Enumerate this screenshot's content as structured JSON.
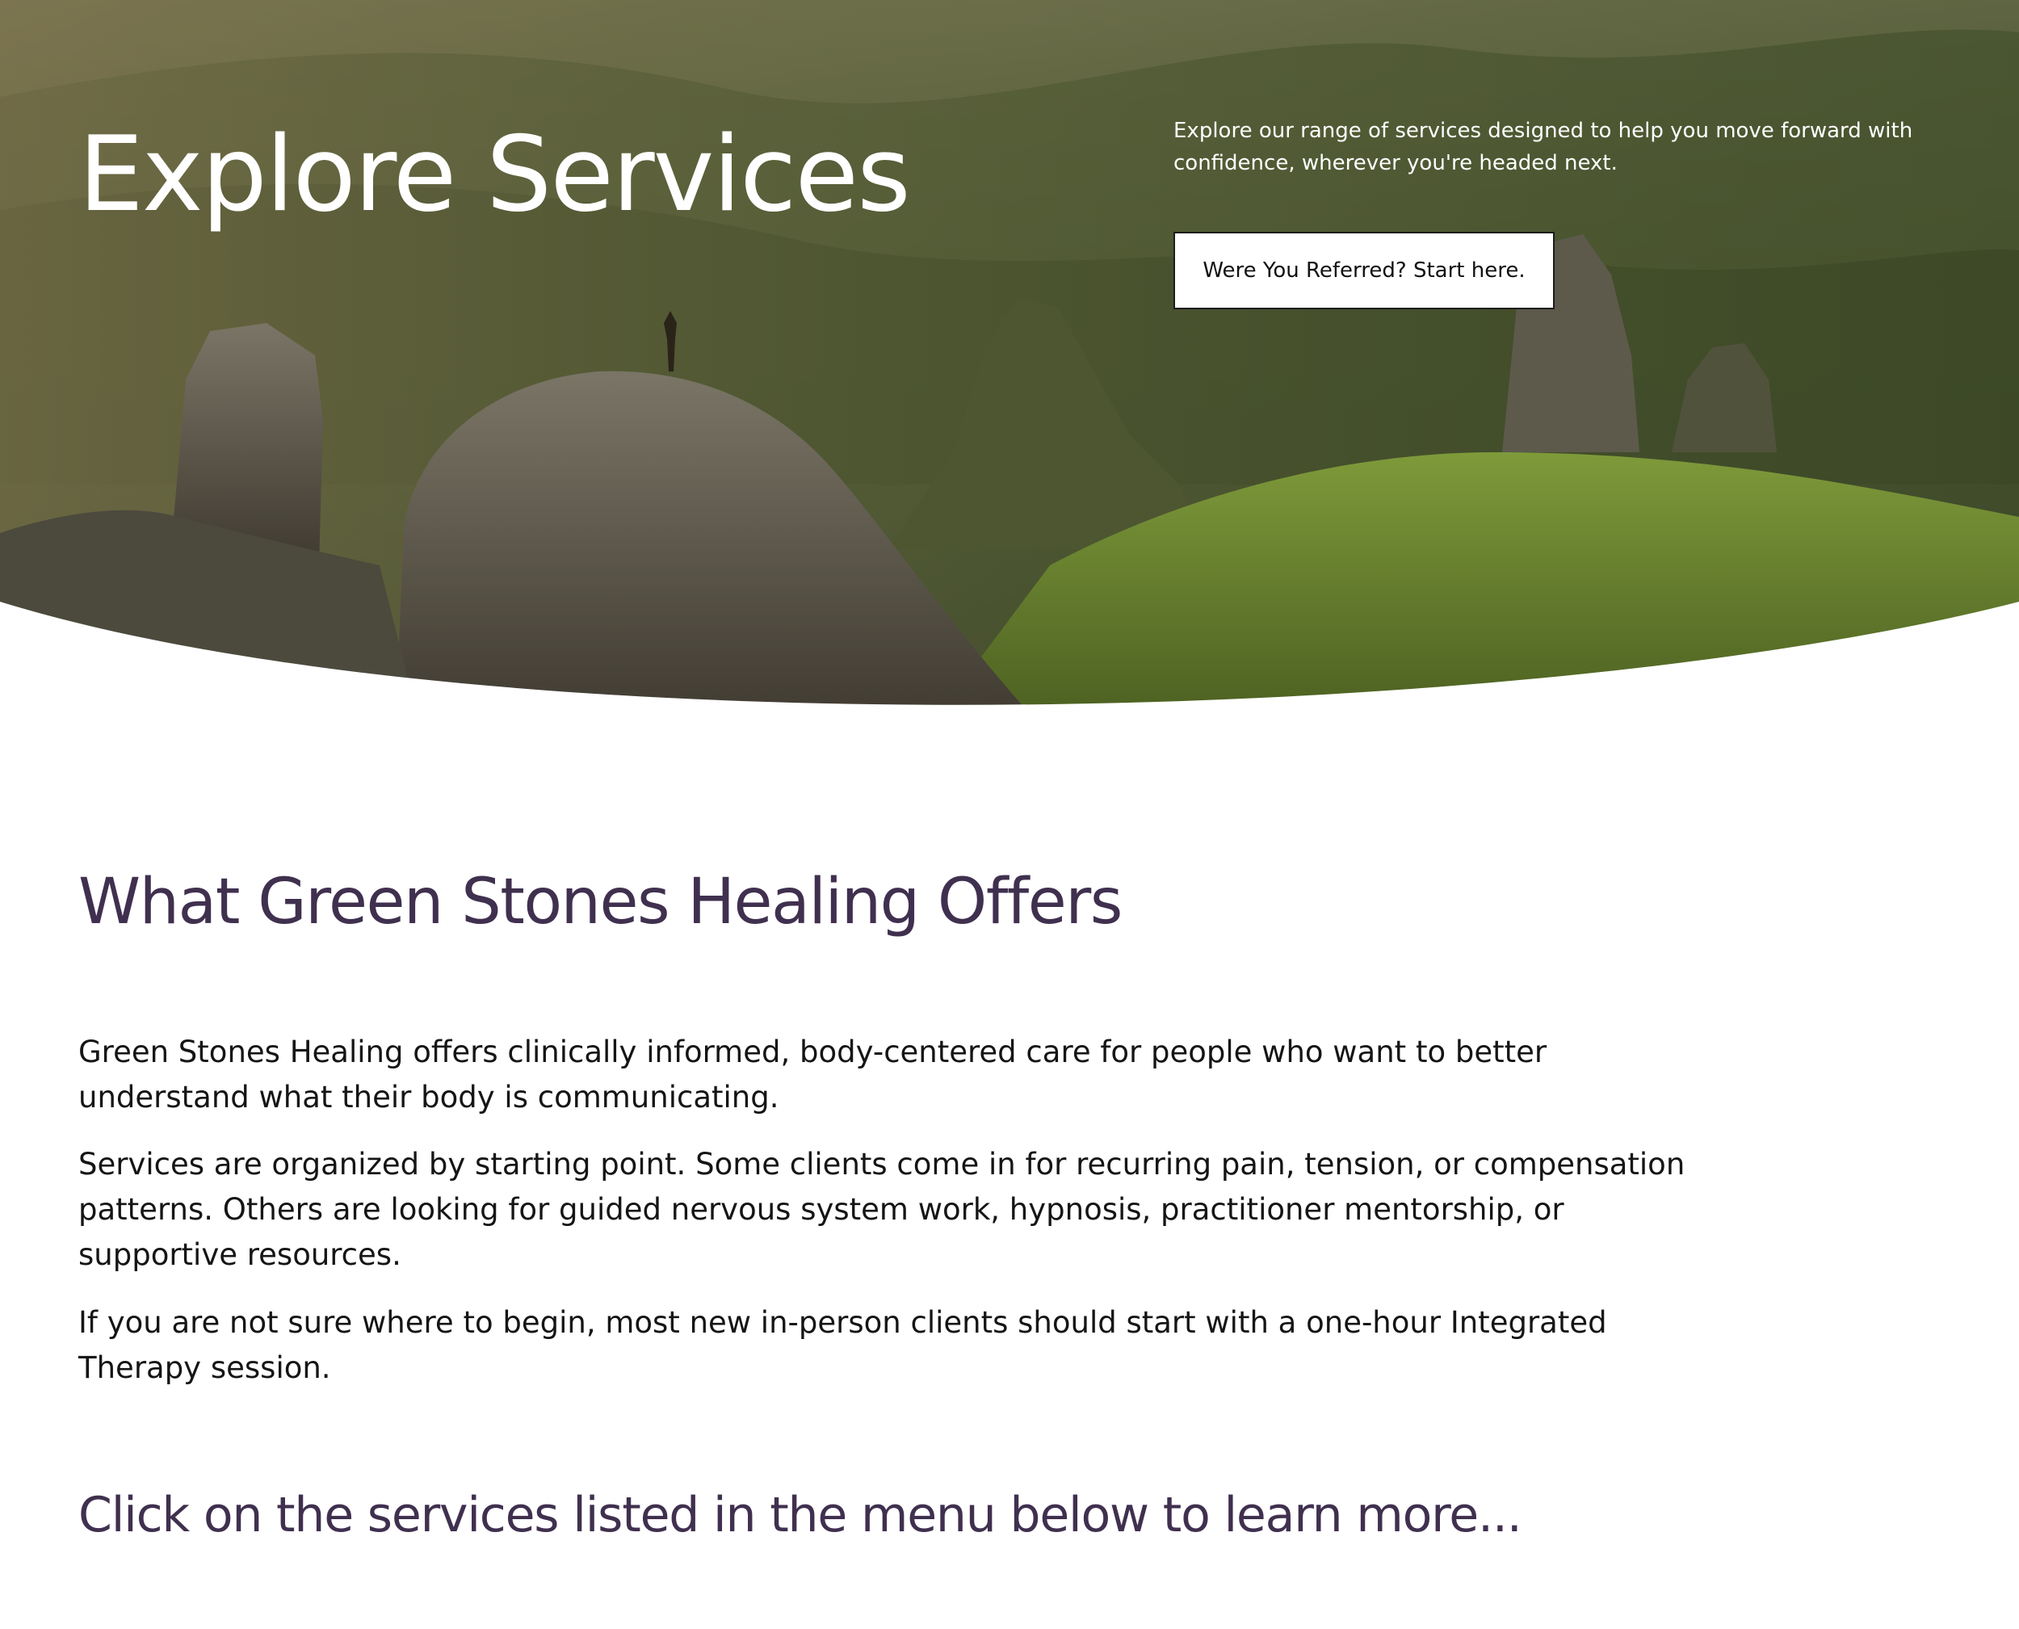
{
  "hero": {
    "title": "Explore Services",
    "description": "Explore our range of services designed to help you move forward with confidence, wherever you're headed next.",
    "button_label": "Were You Referred? Start here."
  },
  "offers": {
    "heading": "What Green Stones Healing Offers",
    "paragraphs": [
      "Green Stones Healing offers clinically informed, body-centered care for people who want to better understand what their body is communicating.",
      "Services are organized by starting point. Some clients come in for recurring pain, tension, or compensation patterns. Others are looking for guided nervous system work, hypnosis, practitioner mentorship, or supportive resources.",
      "If you are not sure where to begin, most new in-person clients should start with a one-hour Integrated Therapy session."
    ],
    "cta_heading": "Click on the services listed in the menu below to learn more..."
  },
  "colors": {
    "heading_purple": "#40304f",
    "body_text": "#151515",
    "hero_text": "#ffffff"
  }
}
